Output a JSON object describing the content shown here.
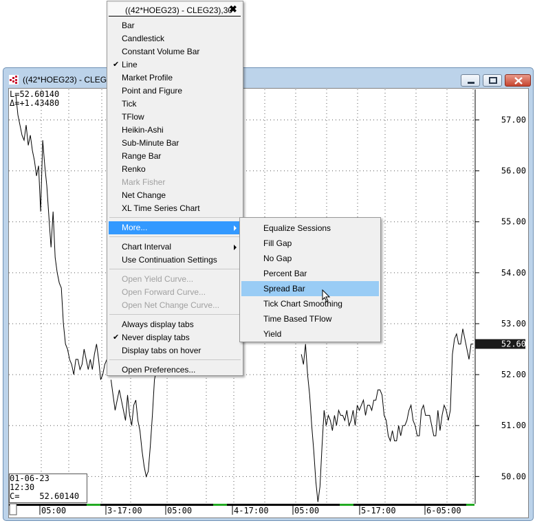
{
  "window": {
    "title": "((42*HOEG23) - CLEG23),30"
  },
  "readout": {
    "last": "L=52.60140",
    "delta": "Δ=+1.43480"
  },
  "price_box": {
    "date": "01-06-23",
    "time": "12:30",
    "close": "C=    52.60140"
  },
  "current_price_label": "52.60",
  "context_menu": {
    "header": "((42*HOEG23) - CLEG23),30",
    "close_glyph": "✖",
    "check_glyph": "✔",
    "items": [
      {
        "label": "Bar",
        "checked": false,
        "disabled": false
      },
      {
        "label": "Candlestick",
        "checked": false,
        "disabled": false
      },
      {
        "label": "Constant Volume Bar",
        "checked": false,
        "disabled": false
      },
      {
        "label": "Line",
        "checked": true,
        "disabled": false
      },
      {
        "label": "Market Profile",
        "checked": false,
        "disabled": false
      },
      {
        "label": "Point and Figure",
        "checked": false,
        "disabled": false
      },
      {
        "label": "Tick",
        "checked": false,
        "disabled": false
      },
      {
        "label": "TFlow",
        "checked": false,
        "disabled": false
      },
      {
        "label": "Heikin-Ashi",
        "checked": false,
        "disabled": false
      },
      {
        "label": "Sub-Minute Bar",
        "checked": false,
        "disabled": false
      },
      {
        "label": "Range Bar",
        "checked": false,
        "disabled": false
      },
      {
        "label": "Renko",
        "checked": false,
        "disabled": false
      },
      {
        "label": "Mark Fisher",
        "checked": false,
        "disabled": true
      },
      {
        "label": "Net Change",
        "checked": false,
        "disabled": false
      },
      {
        "label": "XL Time Series Chart",
        "checked": false,
        "disabled": false
      }
    ],
    "more": "More...",
    "group2": [
      {
        "label": "Chart Interval",
        "submenu": true
      },
      {
        "label": "Use Continuation Settings",
        "submenu": false
      }
    ],
    "group3": [
      {
        "label": "Open Yield Curve...",
        "disabled": true
      },
      {
        "label": "Open Forward Curve...",
        "disabled": true
      },
      {
        "label": "Open Net Change Curve...",
        "disabled": true
      }
    ],
    "group4": [
      {
        "label": "Always display tabs",
        "checked": false
      },
      {
        "label": "Never display tabs",
        "checked": true
      },
      {
        "label": "Display tabs on hover",
        "checked": false
      }
    ],
    "preferences": "Open Preferences..."
  },
  "more_submenu": {
    "items": [
      "Equalize Sessions",
      "Fill Gap",
      "No Gap",
      "Percent Bar",
      "Spread Bar",
      "Tick Chart Smoothing",
      "Time Based TFlow",
      "Yield"
    ],
    "hovered": "Spread Bar"
  },
  "colors": {
    "window_frame": "#bcd3ea",
    "menu_highlight": "#3399ff",
    "submenu_hover": "#99ccf5",
    "price_tag": "#1a1a1a",
    "session_marker": "#22aa22"
  },
  "chart_data": {
    "type": "line",
    "ylim": [
      49.6,
      57.6
    ],
    "yticks": [
      "57.00",
      "56.00",
      "55.00",
      "54.00",
      "53.00",
      "52.00",
      "51.00",
      "50.00"
    ],
    "ytick_values": [
      57,
      56,
      55,
      54,
      53,
      52,
      51,
      50
    ],
    "xticks": [
      "05:00",
      "3-17:00",
      "05:00",
      "4-17:00",
      "05:00",
      "5-17:00",
      "6-05:00"
    ],
    "grid": true,
    "last_value": 52.6014,
    "segments": [
      {
        "name": "",
        "x": [
          0,
          1,
          2,
          3,
          4,
          5,
          6,
          7,
          8,
          9,
          10,
          11,
          12,
          13,
          14,
          15,
          16,
          17,
          18,
          19,
          20,
          21,
          22,
          23,
          24,
          25,
          26,
          27,
          28,
          29,
          30,
          31,
          32,
          33,
          34,
          35,
          36,
          37,
          38,
          39,
          40,
          41,
          42,
          43,
          44,
          45
        ],
        "y": [
          57.5,
          57.1,
          56.9,
          56.7,
          56.6,
          56.9,
          56.5,
          56.7,
          56.4,
          56.2,
          55.9,
          56.1,
          55.2,
          56.6,
          56.1,
          55.7,
          55.1,
          54.5,
          55.2,
          54.3,
          54.0,
          53.8,
          53.7,
          53.0,
          52.6,
          52.5,
          52.3,
          52.2,
          52.0,
          52.3,
          52.3,
          52.1,
          52.2,
          52.5,
          52.3,
          52.1,
          52.3,
          52.1,
          52.4,
          52.6,
          52.3,
          51.9,
          52.0,
          52.2,
          52.3,
          52.4
        ]
      },
      {
        "name": "",
        "x": [
          46,
          47,
          48,
          49,
          50,
          51,
          52,
          53,
          54,
          55,
          56,
          57,
          58,
          59,
          60,
          61,
          62,
          63,
          64,
          65,
          66,
          67,
          68,
          69,
          70,
          71,
          72,
          73,
          74,
          75
        ],
        "y": [
          51.9,
          51.6,
          51.3,
          51.5,
          51.7,
          51.5,
          51.3,
          51.1,
          51.6,
          51.2,
          51.0,
          51.4,
          51.5,
          51.1,
          50.9,
          50.5,
          50.2,
          50.0,
          50.1,
          50.6,
          51.2,
          51.9,
          52.1,
          52.2,
          52.3,
          52.1,
          52.6,
          52.3,
          52.0,
          52.2
        ]
      },
      {
        "name": "",
        "x": [
          138,
          139,
          140,
          141,
          142,
          143,
          144,
          145,
          146,
          147,
          148,
          149,
          150,
          151,
          152,
          153,
          154,
          155,
          156,
          157,
          158,
          159,
          160,
          161,
          162,
          163,
          164,
          165,
          166,
          167,
          168,
          169,
          170,
          171,
          172,
          173,
          174,
          175,
          176,
          177,
          178,
          179,
          180,
          181,
          182,
          183,
          184,
          185,
          186,
          187,
          188,
          189,
          190,
          191,
          192,
          193,
          194,
          195,
          196,
          197,
          198,
          199,
          200,
          201,
          202,
          203,
          204,
          205,
          206,
          207,
          208,
          209,
          210,
          211,
          212,
          213,
          214,
          215,
          216,
          217,
          218,
          219,
          220,
          221
        ],
        "y": [
          52.4,
          52.2,
          52.6,
          52.0,
          51.6,
          51.0,
          50.5,
          49.9,
          49.5,
          49.8,
          50.6,
          51.3,
          51.0,
          51.2,
          51.1,
          50.9,
          51.2,
          51.0,
          51.3,
          51.2,
          51.2,
          51.1,
          51.3,
          51.0,
          51.1,
          51.3,
          51.0,
          51.4,
          51.3,
          51.4,
          51.5,
          51.2,
          51.4,
          51.4,
          51.3,
          51.5,
          51.5,
          51.7,
          51.7,
          51.6,
          51.2,
          51.1,
          50.8,
          50.7,
          50.9,
          50.7,
          50.7,
          51.0,
          50.8,
          51.0,
          51.0,
          51.1,
          51.3,
          51.4,
          51.1,
          51.0,
          50.8,
          50.8,
          51.3,
          51.4,
          51.2,
          51.2,
          51.2,
          51.0,
          50.8,
          50.8,
          51.3,
          50.9,
          51.2,
          51.4,
          51.3,
          51.1,
          51.3,
          52.4,
          52.7,
          52.8,
          52.6,
          52.6,
          52.9,
          52.7,
          52.5,
          52.3,
          52.6,
          52.6
        ]
      }
    ]
  }
}
